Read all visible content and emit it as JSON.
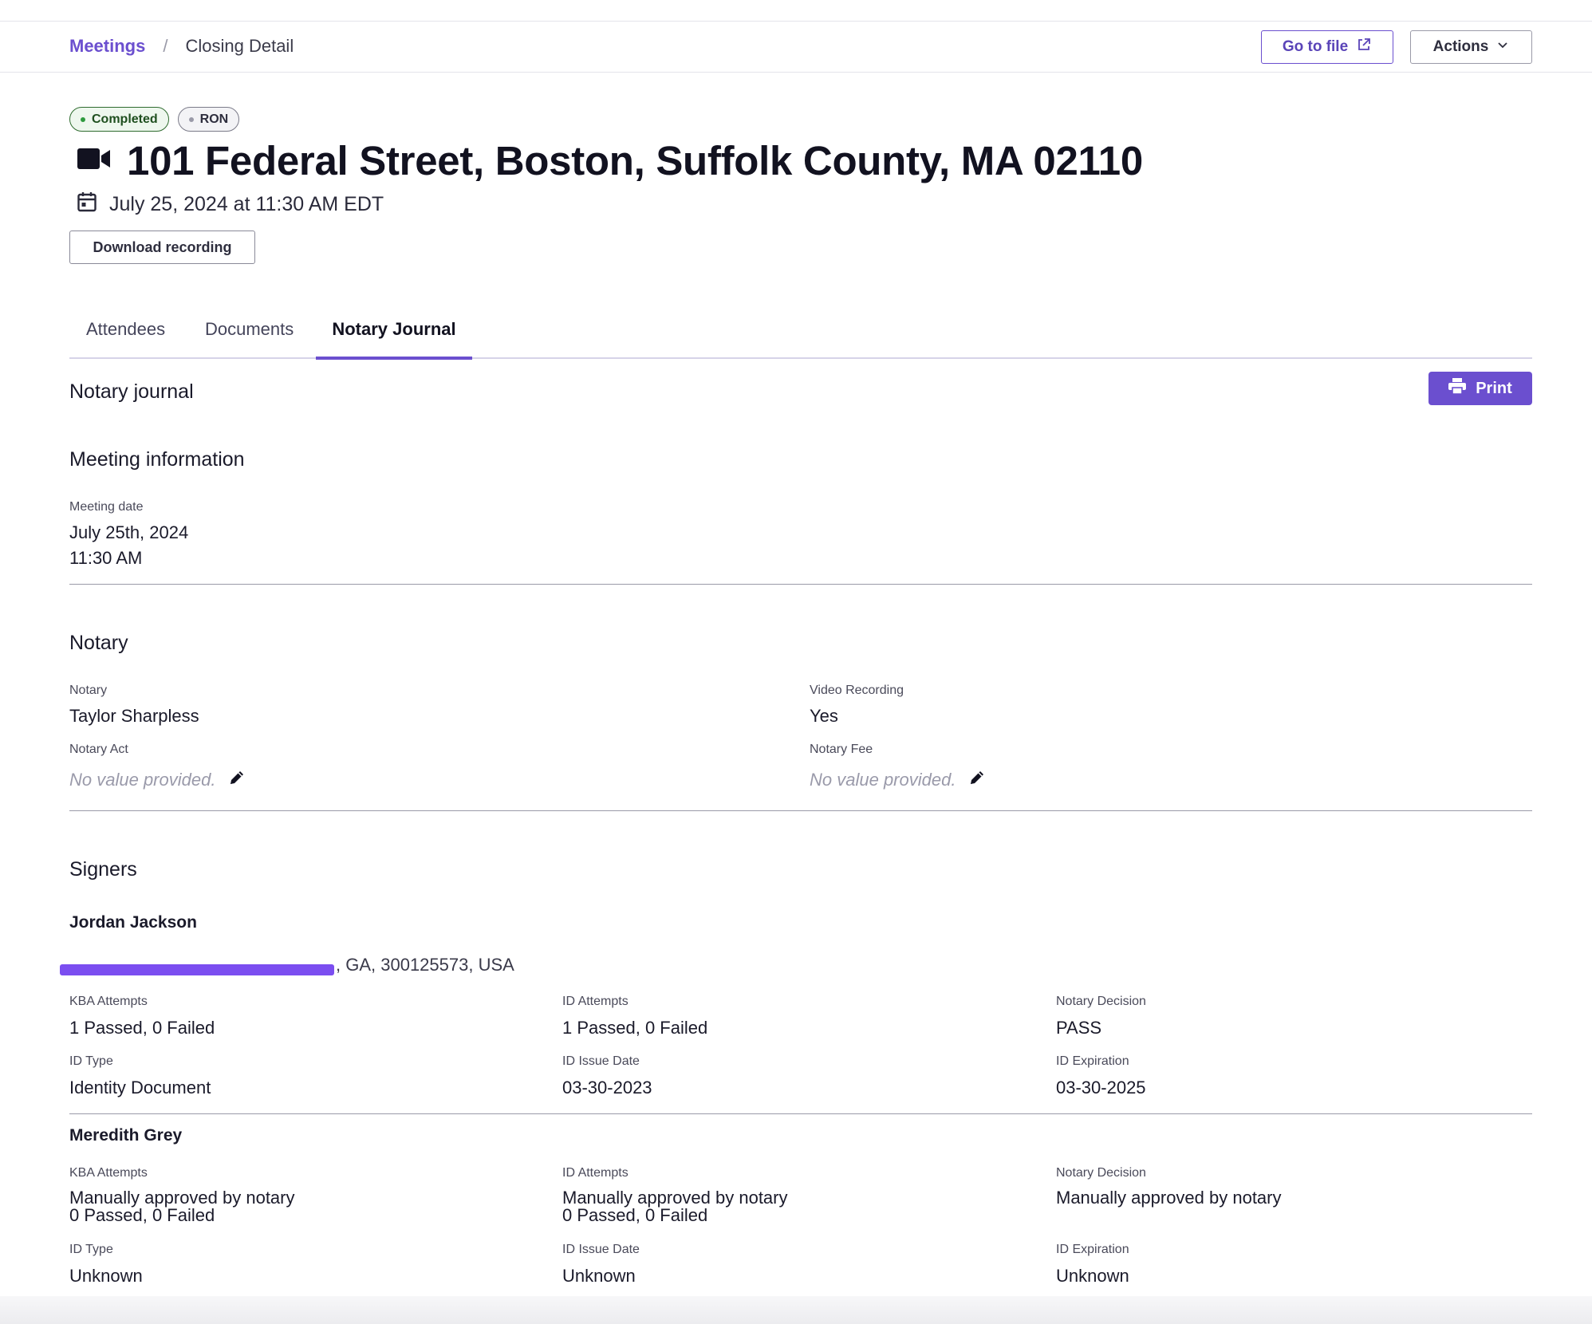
{
  "breadcrumb": {
    "parent": "Meetings",
    "separator": "/",
    "current": "Closing Detail"
  },
  "header": {
    "goto_file_label": "Go to file",
    "actions_label": "Actions"
  },
  "badges": {
    "status": "Completed",
    "type": "RON"
  },
  "meeting": {
    "title": "101 Federal Street, Boston, Suffolk County, MA 02110",
    "datetime": "July 25, 2024 at 11:30 AM EDT",
    "download_label": "Download recording"
  },
  "tabs": [
    {
      "label": "Attendees"
    },
    {
      "label": "Documents"
    },
    {
      "label": "Notary Journal",
      "active": true
    }
  ],
  "journal": {
    "title": "Notary journal",
    "print_label": "Print",
    "meeting_info": {
      "heading": "Meeting information",
      "date_label": "Meeting date",
      "date_value": "July 25th, 2024",
      "time_value": "11:30 AM"
    },
    "notary": {
      "heading": "Notary",
      "notary_label": "Notary",
      "notary_value": "Taylor Sharpless",
      "video_label": "Video Recording",
      "video_value": "Yes",
      "act_label": "Notary Act",
      "act_value": "No value provided.",
      "fee_label": "Notary Fee",
      "fee_value": "No value provided."
    },
    "signers": {
      "heading": "Signers",
      "list": [
        {
          "name": "Jordan Jackson",
          "address_visible": ", GA, 300125573, USA",
          "kba_label": "KBA Attempts",
          "kba_value": "1 Passed, 0 Failed",
          "id_attempts_label": "ID Attempts",
          "id_attempts_value": "1 Passed, 0 Failed",
          "decision_label": "Notary Decision",
          "decision_value": "PASS",
          "id_type_label": "ID Type",
          "id_type_value": "Identity Document",
          "issue_label": "ID Issue Date",
          "issue_value": "03-30-2023",
          "exp_label": "ID Expiration",
          "exp_value": "03-30-2025"
        },
        {
          "name": "Meredith Grey",
          "kba_label": "KBA Attempts",
          "kba_line1": "Manually approved by notary",
          "kba_line2": "0 Passed, 0 Failed",
          "id_attempts_label": "ID Attempts",
          "id_attempts_line1": "Manually approved by notary",
          "id_attempts_line2": "0 Passed, 0 Failed",
          "decision_label": "Notary Decision",
          "decision_value": "Manually approved by notary",
          "id_type_label": "ID Type",
          "id_type_value": "Unknown",
          "issue_label": "ID Issue Date",
          "issue_value": "Unknown",
          "exp_label": "ID Expiration",
          "exp_value": "Unknown"
        }
      ]
    }
  },
  "colors": {
    "accent": "#6b4fcf",
    "redaction": "#7b4ef0",
    "success": "#2e9a3e"
  }
}
